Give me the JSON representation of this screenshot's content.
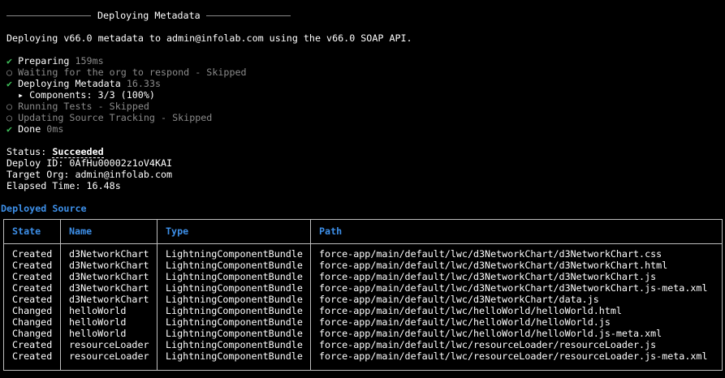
{
  "header_title": "Deploying Metadata",
  "intro": "Deploying v66.0 metadata to admin@infolab.com using the v66.0 SOAP API.",
  "stages": [
    {
      "icon": "check-icon",
      "mark": "✔",
      "label": "Preparing",
      "detail": "159ms",
      "state": "done"
    },
    {
      "icon": "circle-icon",
      "mark": "○",
      "label": "Waiting for the org to respond - Skipped",
      "detail": "",
      "state": "skipped"
    },
    {
      "icon": "check-icon",
      "mark": "✔",
      "label": "Deploying Metadata",
      "detail": "16.33s",
      "state": "done"
    },
    {
      "icon": "triangle-right-icon",
      "mark": "▸",
      "label": "Components: 3/3 (100%)",
      "detail": "",
      "state": "sub"
    },
    {
      "icon": "circle-icon",
      "mark": "○",
      "label": "Running Tests - Skipped",
      "detail": "",
      "state": "skipped"
    },
    {
      "icon": "circle-icon",
      "mark": "○",
      "label": "Updating Source Tracking - Skipped",
      "detail": "",
      "state": "skipped"
    },
    {
      "icon": "check-icon",
      "mark": "✔",
      "label": "Done",
      "detail": "0ms",
      "state": "done"
    }
  ],
  "summary": {
    "status_label": "Status:",
    "status_value": "Succeeded",
    "deploy_id": "Deploy ID: 0AfHu00002z1oV4KAI",
    "target_org": "Target Org: admin@infolab.com",
    "elapsed": "Elapsed Time: 16.48s"
  },
  "section_title": "Deployed Source",
  "table": {
    "headers": [
      "State",
      "Name",
      "Type",
      "Path"
    ],
    "rows": [
      [
        "Created",
        "d3NetworkChart",
        "LightningComponentBundle",
        "force-app/main/default/lwc/d3NetworkChart/d3NetworkChart.css"
      ],
      [
        "Created",
        "d3NetworkChart",
        "LightningComponentBundle",
        "force-app/main/default/lwc/d3NetworkChart/d3NetworkChart.html"
      ],
      [
        "Created",
        "d3NetworkChart",
        "LightningComponentBundle",
        "force-app/main/default/lwc/d3NetworkChart/d3NetworkChart.js"
      ],
      [
        "Created",
        "d3NetworkChart",
        "LightningComponentBundle",
        "force-app/main/default/lwc/d3NetworkChart/d3NetworkChart.js-meta.xml"
      ],
      [
        "Created",
        "d3NetworkChart",
        "LightningComponentBundle",
        "force-app/main/default/lwc/d3NetworkChart/data.js"
      ],
      [
        "Changed",
        "helloWorld",
        "LightningComponentBundle",
        "force-app/main/default/lwc/helloWorld/helloWorld.html"
      ],
      [
        "Changed",
        "helloWorld",
        "LightningComponentBundle",
        "force-app/main/default/lwc/helloWorld/helloWorld.js"
      ],
      [
        "Changed",
        "helloWorld",
        "LightningComponentBundle",
        "force-app/main/default/lwc/helloWorld/helloWorld.js-meta.xml"
      ],
      [
        "Created",
        "resourceLoader",
        "LightningComponentBundle",
        "force-app/main/default/lwc/resourceLoader/resourceLoader.js"
      ],
      [
        "Created",
        "resourceLoader",
        "LightningComponentBundle",
        "force-app/main/default/lwc/resourceLoader/resourceLoader.js-meta.xml"
      ]
    ]
  },
  "colors": {
    "background": "#000000",
    "text": "#ffffff",
    "dim": "#8a8a8a",
    "success": "#3fbf5a",
    "accent": "#3d8fe8",
    "border": "#bfbfbf"
  }
}
